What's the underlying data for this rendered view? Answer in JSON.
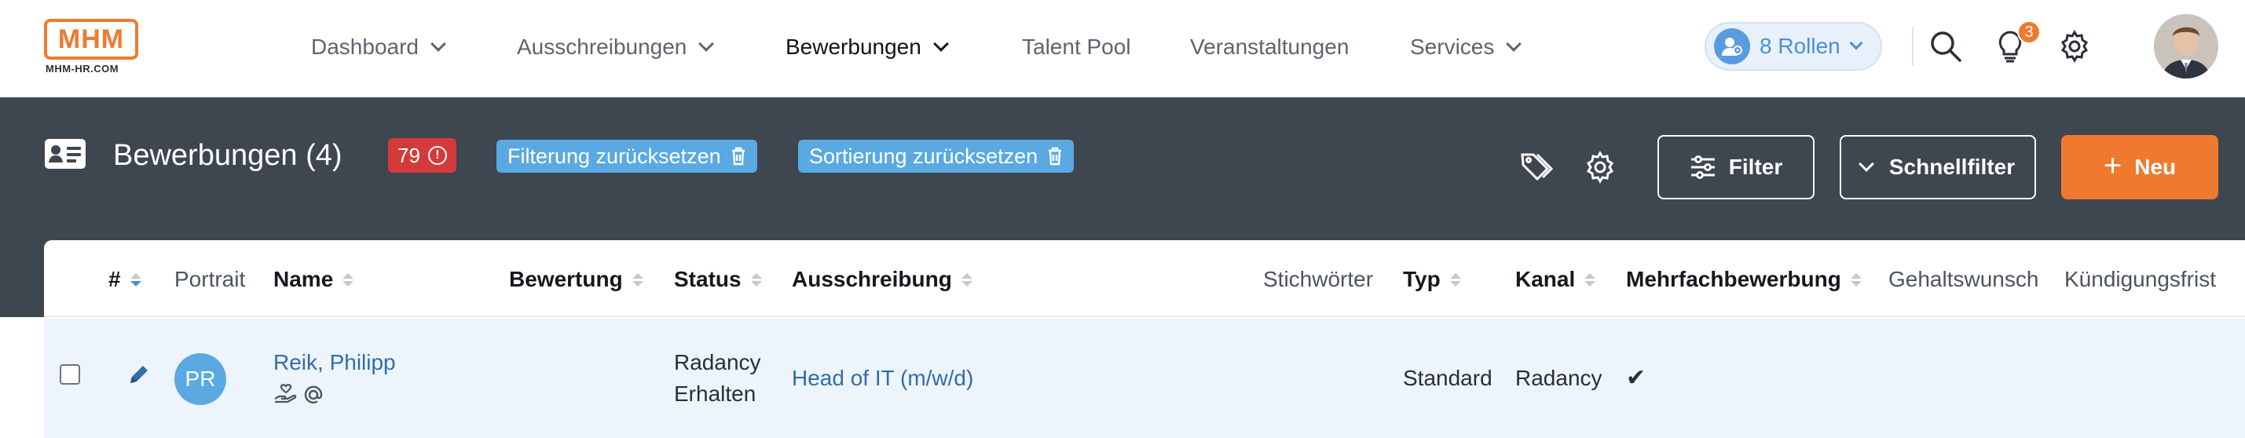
{
  "logo": {
    "text": "MHM",
    "subtitle": "MHM-HR.COM"
  },
  "nav": [
    {
      "label": "Dashboard",
      "has_dropdown": true,
      "active": false
    },
    {
      "label": "Ausschreibungen",
      "has_dropdown": true,
      "active": false
    },
    {
      "label": "Bewerbungen",
      "has_dropdown": true,
      "active": true
    },
    {
      "label": "Talent Pool",
      "has_dropdown": false,
      "active": false
    },
    {
      "label": "Veranstaltungen",
      "has_dropdown": false,
      "active": false
    },
    {
      "label": "Services",
      "has_dropdown": true,
      "active": false
    }
  ],
  "roles": {
    "label": "8 Rollen"
  },
  "notifications": {
    "count": "3"
  },
  "header": {
    "title": "Bewerbungen (4)",
    "badge_count": "79",
    "reset_filter": "Filterung zurücksetzen",
    "reset_sort": "Sortierung zurücksetzen",
    "filter_label": "Filter",
    "quickfilter_label": "Schnellfilter",
    "new_label": "Neu"
  },
  "table": {
    "columns": {
      "num": "#",
      "portrait": "Portrait",
      "name": "Name",
      "rating": "Bewertung",
      "status": "Status",
      "posting": "Ausschreibung",
      "keywords": "Stichwörter",
      "type": "Typ",
      "channel": "Kanal",
      "multi": "Mehrfachbewerbung",
      "salary": "Gehaltswunsch",
      "notice": "Kündigungsfrist"
    },
    "rows": [
      {
        "initials": "PR",
        "name": "Reik, Philipp",
        "status_line1": "Radancy",
        "status_line2": "Erhalten",
        "posting": "Head of IT (m/w/d)",
        "type": "Standard",
        "channel": "Radancy",
        "multi": "✔"
      }
    ]
  },
  "colors": {
    "brand_orange": "#ef7a2f",
    "header_band": "#3e4650",
    "chip_blue": "#5aa9e2",
    "badge_red": "#d53a3a",
    "link_blue": "#2f6ea8",
    "row_highlight": "#eef4fb"
  }
}
